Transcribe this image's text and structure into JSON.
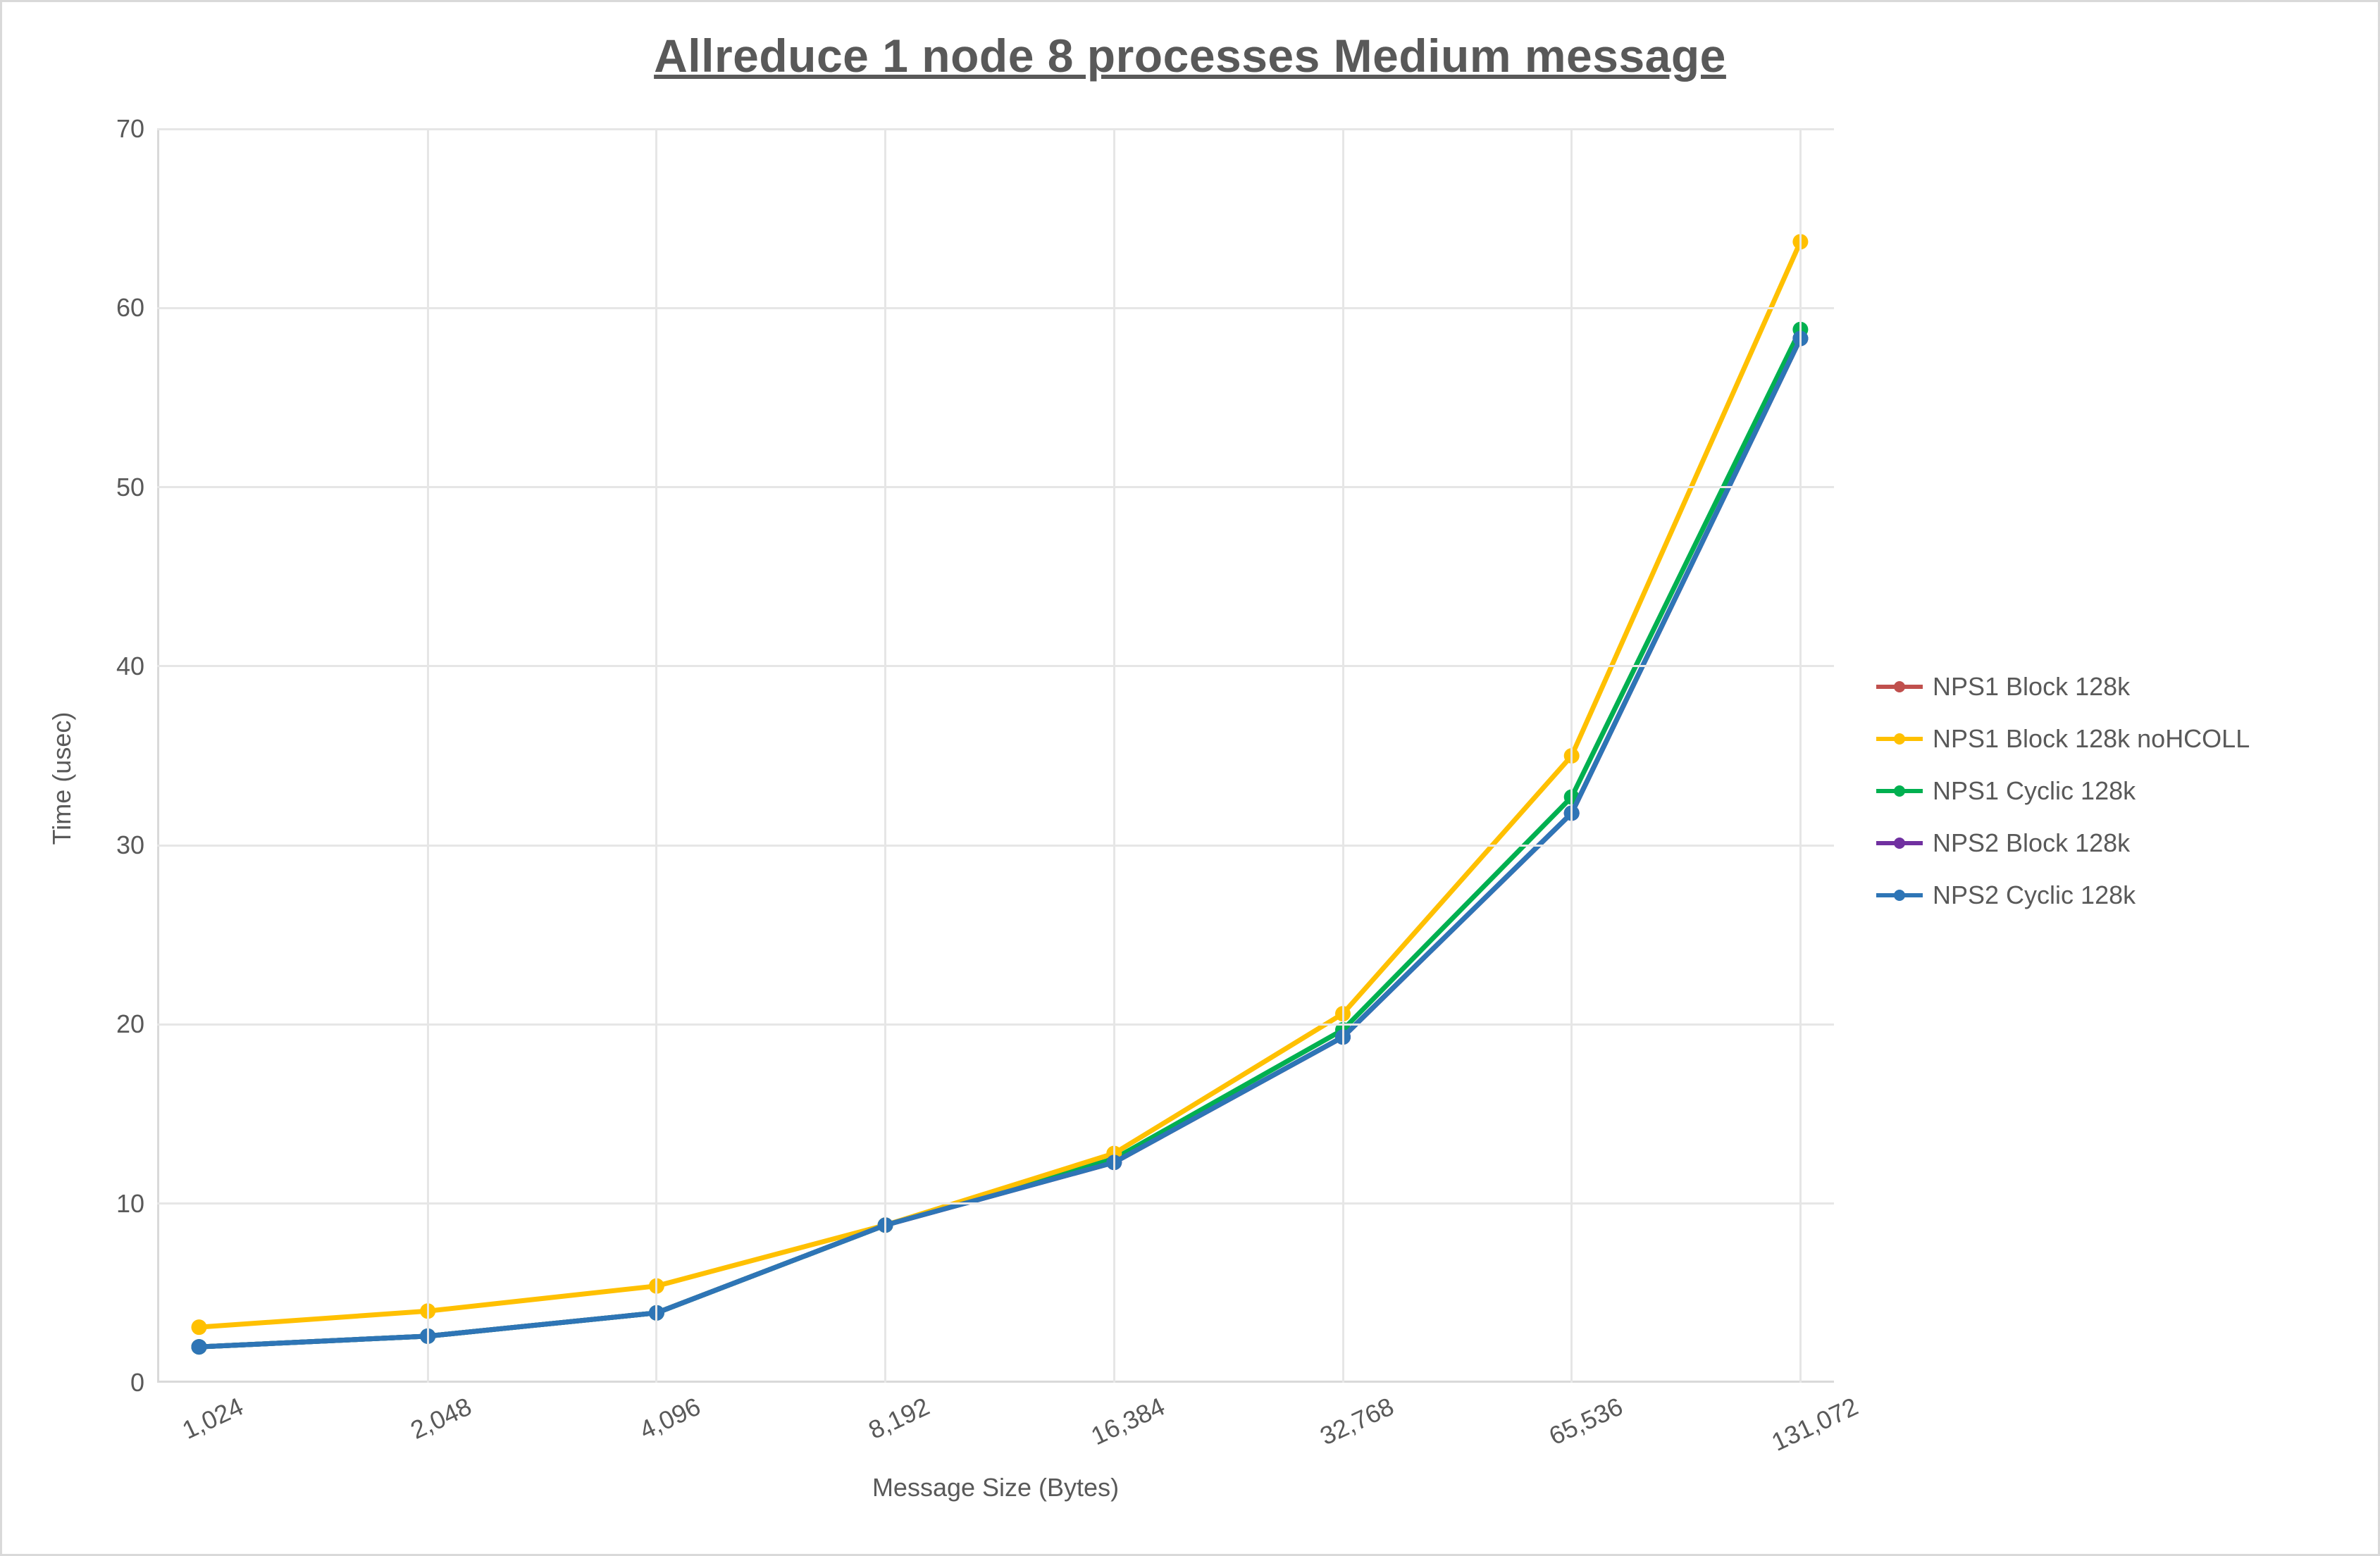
{
  "chart_data": {
    "type": "line",
    "title": "Allreduce 1 node 8 processes Medium message",
    "xlabel": "Message Size (Bytes)",
    "ylabel": "Time (usec)",
    "ylim": [
      0,
      70
    ],
    "yticks": [
      0,
      10,
      20,
      30,
      40,
      50,
      60,
      70
    ],
    "x_categories_numeric": [
      1024,
      2048,
      4096,
      8192,
      16384,
      32768,
      65536,
      131072
    ],
    "x_categories": [
      "1,024",
      "2,048",
      "4,096",
      "8,192",
      "16,384",
      "32,768",
      "65,536",
      "131,072"
    ],
    "series": [
      {
        "name": "NPS1 Block 128k",
        "color": "#c0504d",
        "values": [
          2.0,
          2.6,
          3.9,
          8.8,
          12.3,
          19.3,
          31.8,
          58.3
        ]
      },
      {
        "name": "NPS1 Block 128k noHCOLL",
        "color": "#ffc000",
        "values": [
          3.1,
          4.0,
          5.4,
          8.8,
          12.8,
          20.6,
          35.0,
          63.7
        ]
      },
      {
        "name": "NPS1 Cyclic 128k",
        "color": "#00b050",
        "values": [
          2.0,
          2.6,
          3.9,
          8.8,
          12.5,
          19.7,
          32.7,
          58.8
        ]
      },
      {
        "name": "NPS2 Block 128k",
        "color": "#7030a0",
        "values": [
          2.0,
          2.6,
          3.9,
          8.8,
          12.3,
          19.3,
          31.8,
          58.3
        ]
      },
      {
        "name": "NPS2 Cyclic 128k",
        "color": "#2e75b6",
        "values": [
          2.0,
          2.6,
          3.9,
          8.8,
          12.3,
          19.3,
          31.8,
          58.3
        ]
      }
    ]
  }
}
